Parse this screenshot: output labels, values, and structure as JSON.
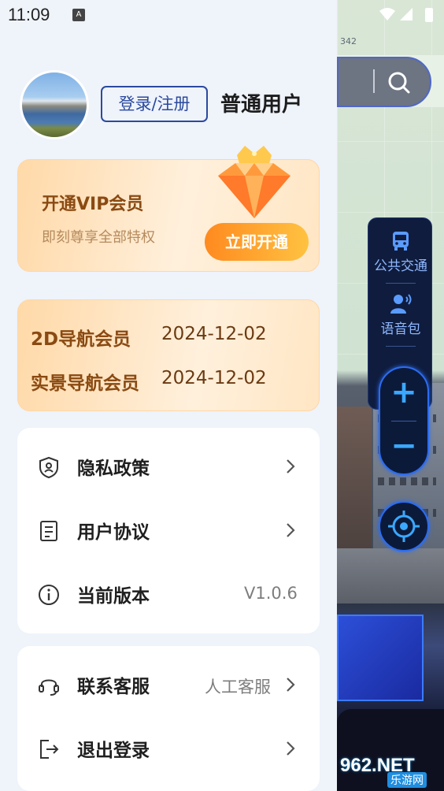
{
  "status_bar": {
    "time": "11:09",
    "notif_icon": "a-icon",
    "icons": [
      "wifi-icon",
      "signal-icon",
      "battery-icon"
    ]
  },
  "user": {
    "login_label": "登录/注册",
    "user_type": "普通用户"
  },
  "vip": {
    "title": "开通VIP会员",
    "subtitle": "即刻尊享全部特权",
    "button": "立即开通"
  },
  "members": [
    {
      "label": "2D导航会员",
      "date": "2024-12-02"
    },
    {
      "label": "实景导航会员",
      "date": "2024-12-02"
    }
  ],
  "menu_group1": [
    {
      "label": "隐私政策",
      "icon": "shield-icon"
    },
    {
      "label": "用户协议",
      "icon": "document-icon"
    },
    {
      "label": "当前版本",
      "icon": "info-icon",
      "value": "V1.0.6"
    }
  ],
  "menu_group2": [
    {
      "label": "联系客服",
      "icon": "headset-icon",
      "value": "人工客服"
    },
    {
      "label": "退出登录",
      "icon": "logout-icon"
    }
  ],
  "map": {
    "tools": [
      "公共交通",
      "语音包"
    ],
    "map_number": "342"
  },
  "watermark": {
    "main": "962.NET",
    "sub": "乐游网"
  },
  "colors": {
    "accent": "#2b4a9e",
    "vip_orange": "#ff8a1f",
    "vip_text": "#8a4a12",
    "drawer_bg": "#eff3fa"
  }
}
